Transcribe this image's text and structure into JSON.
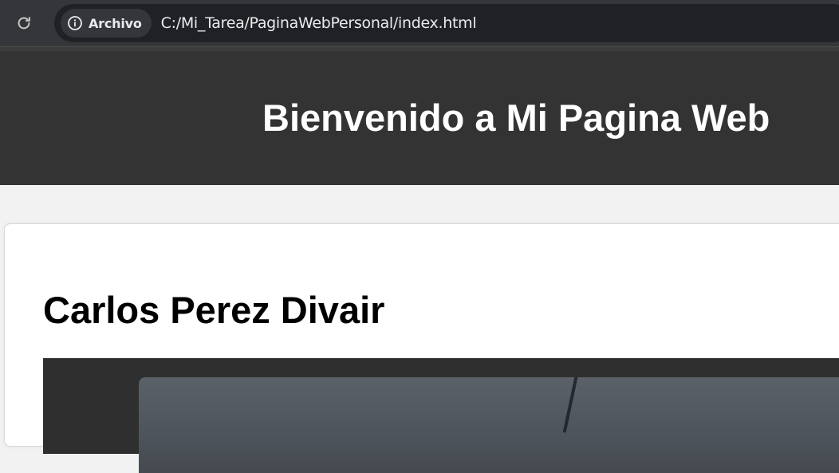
{
  "browser": {
    "site_chip_label": "Archivo",
    "url": "C:/Mi_Tarea/PaginaWebPersonal/index.html",
    "icons": {
      "reload": "reload-icon",
      "info": "info-icon"
    }
  },
  "page": {
    "header_title": "Bienvenido a Mi Pagina Web",
    "person_name": "Carlos Perez Divair"
  },
  "colors": {
    "chrome_bg": "#35363a",
    "omnibox_bg": "#202124",
    "header_bg": "#333333",
    "page_bg": "#f2f2f2",
    "card_bg": "#ffffff"
  }
}
